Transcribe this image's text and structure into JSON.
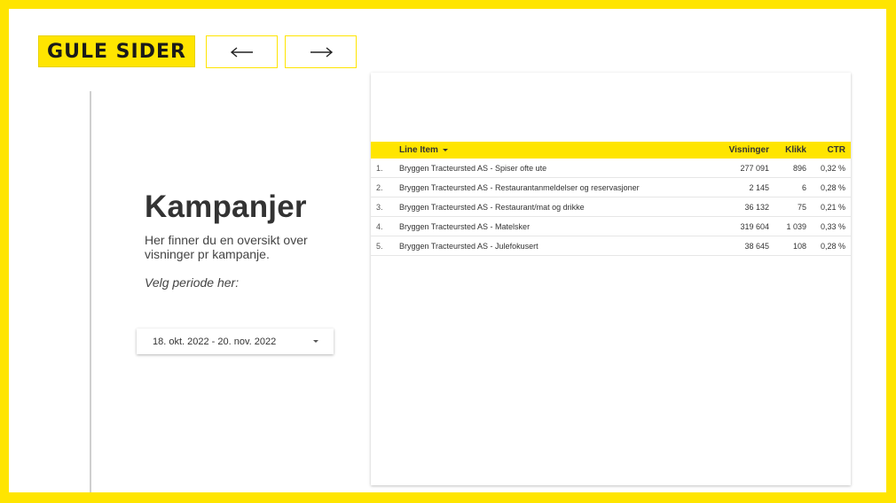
{
  "brand": {
    "logo_text": "GULE SIDER",
    "accent": "#FFE500"
  },
  "nav": {
    "prev_icon": "arrow-left-icon",
    "next_icon": "arrow-right-icon"
  },
  "page": {
    "title": "Kampanjer",
    "description": "Her finner du en oversikt over visninger pr kampanje.",
    "period_label": "Velg periode her:",
    "date_range": "18. okt. 2022 - 20. nov. 2022"
  },
  "table": {
    "headers": {
      "line_item": "Line Item",
      "visninger": "Visninger",
      "klikk": "Klikk",
      "ctr": "CTR"
    },
    "rows": [
      {
        "idx": "1.",
        "name": "Bryggen Tracteursted AS - Spiser ofte ute",
        "visninger": "277 091",
        "klikk": "896",
        "ctr": "0,32 %"
      },
      {
        "idx": "2.",
        "name": "Bryggen Tracteursted AS - Restaurantanmeldelser og reservasjoner",
        "visninger": "2 145",
        "klikk": "6",
        "ctr": "0,28 %"
      },
      {
        "idx": "3.",
        "name": "Bryggen Tracteursted AS - Restaurant/mat og drikke",
        "visninger": "36 132",
        "klikk": "75",
        "ctr": "0,21 %"
      },
      {
        "idx": "4.",
        "name": "Bryggen Tracteursted AS - Matelsker",
        "visninger": "319 604",
        "klikk": "1 039",
        "ctr": "0,33 %"
      },
      {
        "idx": "5.",
        "name": "Bryggen Tracteursted AS - Julefokusert",
        "visninger": "38 645",
        "klikk": "108",
        "ctr": "0,28 %"
      }
    ]
  }
}
